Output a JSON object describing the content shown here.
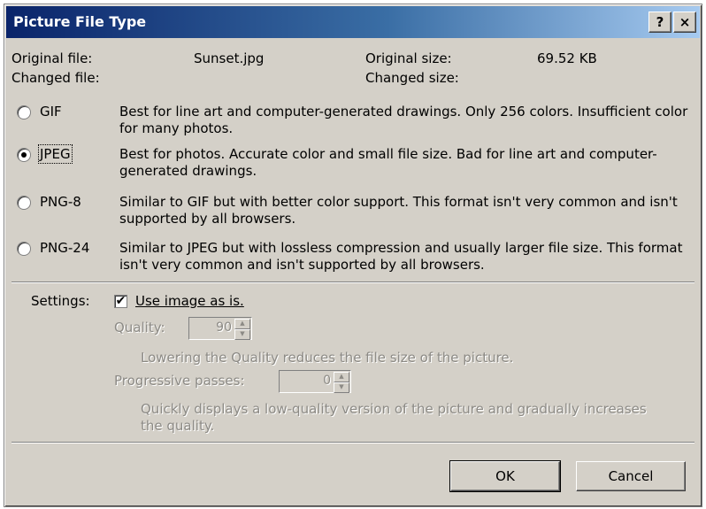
{
  "window": {
    "title": "Picture File Type",
    "help_label": "?",
    "close_label": "×"
  },
  "info": {
    "original_file_label": "Original file:",
    "original_file_value": "Sunset.jpg",
    "original_size_label": "Original size:",
    "original_size_value": "69.52 KB",
    "changed_file_label": "Changed file:",
    "changed_size_label": "Changed size:"
  },
  "formats": [
    {
      "label": "GIF",
      "selected": false,
      "description": "Best for line art and computer-generated drawings.  Only 256 colors. Insufficient color for many photos."
    },
    {
      "label": "JPEG",
      "selected": true,
      "description": "Best for photos.  Accurate color and small file size. Bad for line art and computer-generated drawings."
    },
    {
      "label": "PNG-8",
      "selected": false,
      "description": "Similar to GIF but with better color support.   This format isn't very common and isn't supported by all browsers."
    },
    {
      "label": "PNG-24",
      "selected": false,
      "description": "Similar to JPEG but with lossless compression and usually larger file size.  This format isn't very common and isn't supported by all browsers."
    }
  ],
  "settings": {
    "label": "Settings:",
    "use_as_is_label": "Use image as is.",
    "use_as_is_checked": true,
    "check_mark": "✔",
    "quality_label": "Quality:",
    "quality_value": "90",
    "quality_hint": "Lowering the Quality reduces the file size of the picture.",
    "passes_label": "Progressive passes:",
    "passes_value": "0",
    "passes_hint": "Quickly displays a low-quality version of the picture and gradually increases the quality.",
    "spin_up": "▲",
    "spin_down": "▼"
  },
  "buttons": {
    "ok": "OK",
    "cancel": "Cancel"
  }
}
